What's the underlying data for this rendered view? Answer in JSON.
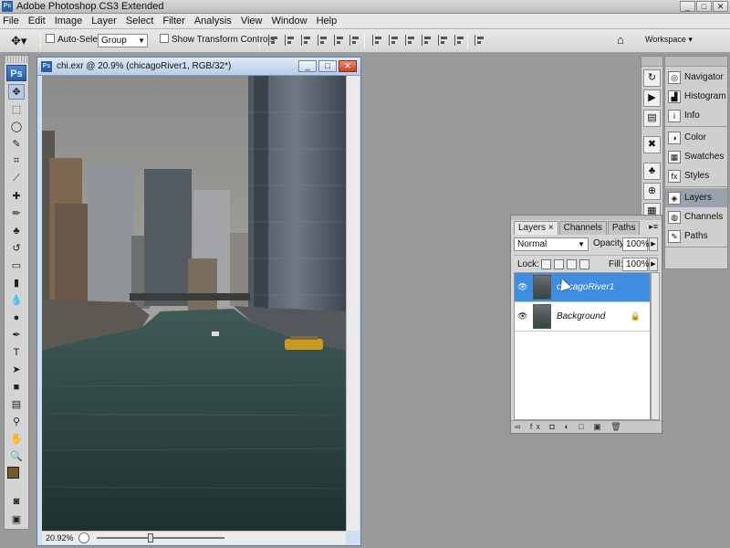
{
  "app": {
    "title": "Adobe Photoshop CS3 Extended",
    "icon": "ps-icon"
  },
  "window_buttons": [
    "_",
    "□",
    "✕"
  ],
  "menubar": [
    "File",
    "Edit",
    "Image",
    "Layer",
    "Select",
    "Filter",
    "Analysis",
    "View",
    "Window",
    "Help"
  ],
  "options_bar": {
    "auto_select_label": "Auto-Select:",
    "auto_select_value": "Group",
    "show_transform_label": "Show Transform Controls",
    "workspace_label": "Workspace ▾"
  },
  "tools": [
    "move",
    "marquee",
    "lasso",
    "quick-select",
    "crop",
    "slice",
    "healing",
    "brush",
    "stamp",
    "history-brush",
    "eraser",
    "gradient",
    "blur",
    "dodge",
    "pen",
    "type",
    "path-select",
    "shape",
    "notes",
    "eyedropper",
    "hand",
    "zoom"
  ],
  "tools_logo": "Ps",
  "document": {
    "title": "chi.exr @ 20.9% (chicagoRiver1, RGB/32*)",
    "zoom": "20.92%"
  },
  "dock": {
    "groups": [
      [
        "Navigator",
        "Histogram",
        "Info"
      ],
      [
        "Color",
        "Swatches",
        "Styles"
      ],
      [
        "Layers",
        "Channels",
        "Paths"
      ]
    ],
    "active": "Layers"
  },
  "layers_panel": {
    "tabs": [
      "Layers ×",
      "Channels",
      "Paths"
    ],
    "blend_mode": "Normal",
    "opacity_label": "Opacity:",
    "opacity_value": "100%",
    "lock_label": "Lock:",
    "fill_label": "Fill:",
    "fill_value": "100%",
    "layers": [
      {
        "name": "chicagoRiver1",
        "selected": true,
        "locked": false
      },
      {
        "name": "Background",
        "selected": false,
        "locked": true
      }
    ],
    "footer": "∞ fx ◘ ◐ □ ▣ 🗑"
  },
  "colors": {
    "accent": "#3e8de0",
    "foreground_swatch": "#7a5a2a",
    "background_swatch": "#ffffff"
  }
}
